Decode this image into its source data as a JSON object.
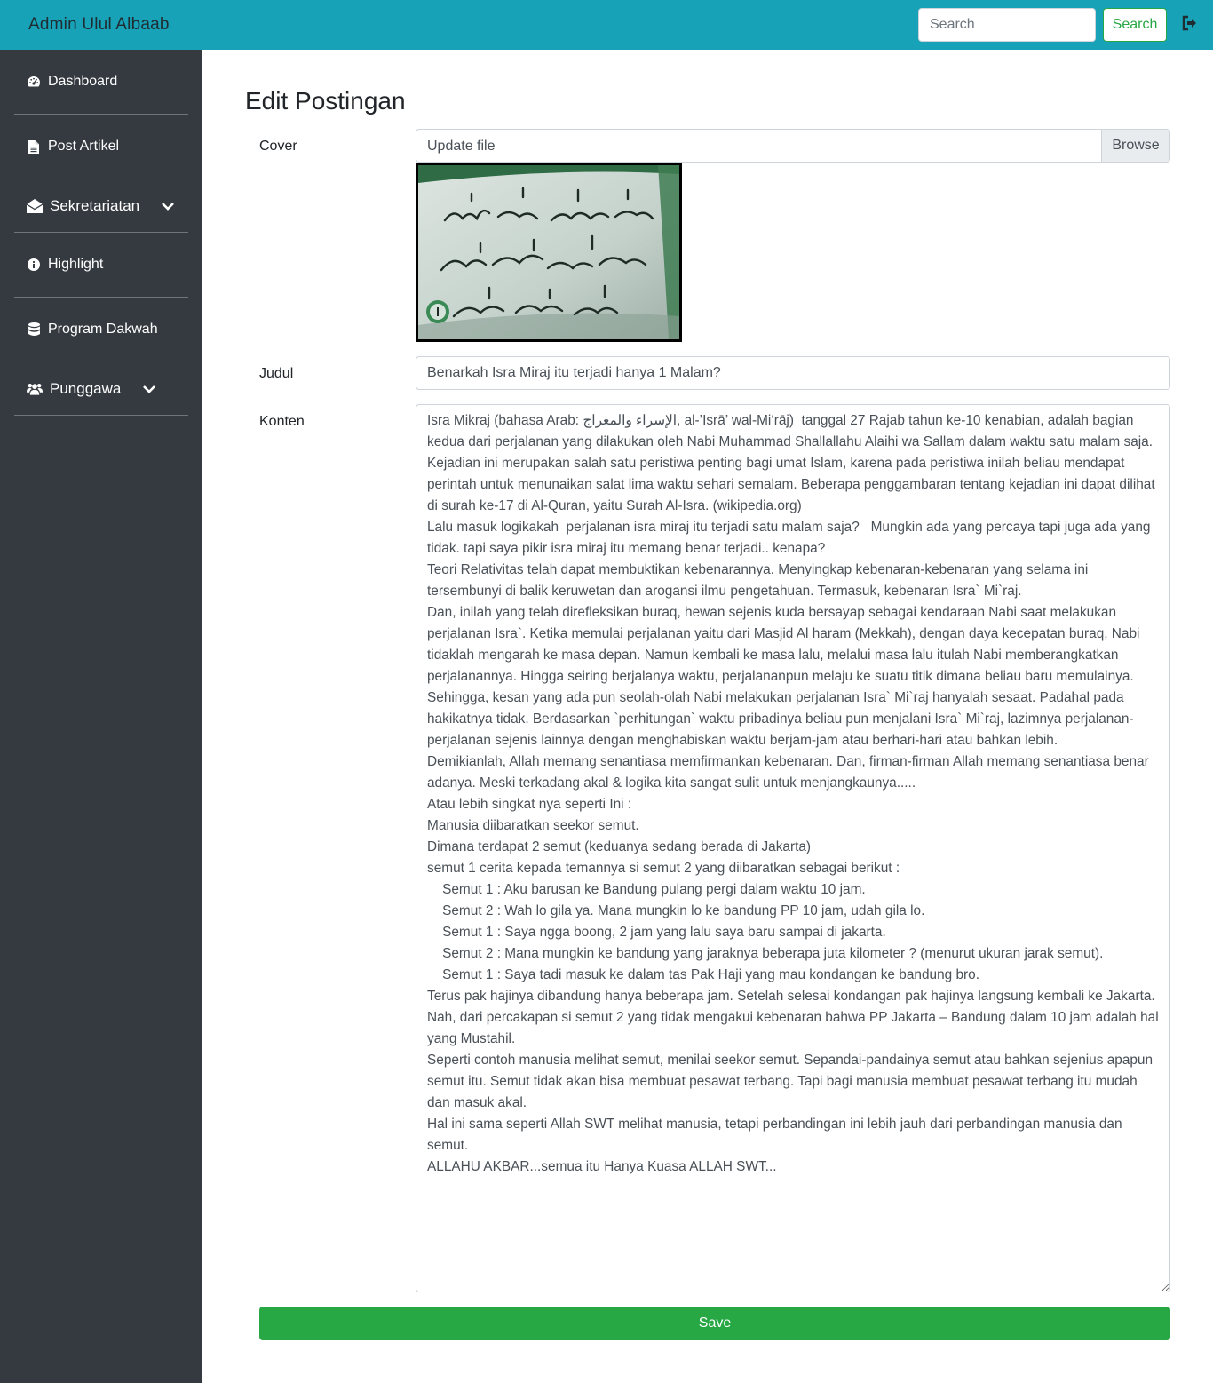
{
  "navbar": {
    "brand": "Admin Ulul Albaab",
    "search_placeholder": "Search",
    "search_button": "Search",
    "logout_icon": "sign-out-icon",
    "color": "#17a2b8"
  },
  "sidebar": {
    "items": [
      {
        "label": "Dashboard",
        "icon": "tachometer-icon"
      },
      {
        "label": "Post Artikel",
        "icon": "file-icon"
      },
      {
        "label": "Sekretariatan",
        "icon": "envelope-open-icon",
        "has_submenu": true
      },
      {
        "label": "Highlight",
        "icon": "info-circle-icon"
      },
      {
        "label": "Program Dakwah",
        "icon": "database-icon"
      },
      {
        "label": "Punggawa",
        "icon": "users-icon",
        "has_submenu": true
      }
    ]
  },
  "form": {
    "title": "Edit Postingan",
    "cover_label": "Cover",
    "file_text": "Update file",
    "browse_label": "Browse",
    "judul_label": "Judul",
    "judul_value": "Benarkah Isra Miraj itu terjadi hanya 1 Malam?",
    "konten_label": "Konten",
    "konten_value": "Isra Mikraj (bahasa Arab: الإسراء والمعراج, al-’Isrā’ wal-Mi‘rāj)  tanggal 27 Rajab tahun ke-10 kenabian, adalah bagian kedua dari perjalanan yang dilakukan oleh Nabi Muhammad Shallallahu Alaihi wa Sallam dalam waktu satu malam saja. Kejadian ini merupakan salah satu peristiwa penting bagi umat Islam, karena pada peristiwa inilah beliau mendapat perintah untuk menunaikan salat lima waktu sehari semalam. Beberapa penggambaran tentang kejadian ini dapat dilihat di surah ke-17 di Al-Quran, yaitu Surah Al-Isra. (wikipedia.org)\nLalu masuk logikakah  perjalanan isra miraj itu terjadi satu malam saja?   Mungkin ada yang percaya tapi juga ada yang tidak. tapi saya pikir isra miraj itu memang benar terjadi.. kenapa?\nTeori Relativitas telah dapat membuktikan kebenarannya. Menyingkap kebenaran-kebenaran yang selama ini tersembunyi di balik keruwetan dan arogansi ilmu pengetahuan. Termasuk, kebenaran Isra` Mi`raj.\nDan, inilah yang telah direfleksikan buraq, hewan sejenis kuda bersayap sebagai kendaraan Nabi saat melakukan perjalanan Isra`. Ketika memulai perjalanan yaitu dari Masjid Al haram (Mekkah), dengan daya kecepatan buraq, Nabi tidaklah mengarah ke masa depan. Namun kembali ke masa lalu, melalui masa lalu itulah Nabi memberangkatkan perjalanannya. Hingga seiring berjalanya waktu, perjalananpun melaju ke suatu titik dimana beliau baru memulainya. Sehingga, kesan yang ada pun seolah-olah Nabi melakukan perjalanan Isra` Mi`raj hanyalah sesaat. Padahal pada hakikatnya tidak. Berdasarkan `perhitungan` waktu pribadinya beliau pun menjalani Isra` Mi`raj, lazimnya perjalanan-perjalanan sejenis lainnya dengan menghabiskan waktu berjam-jam atau berhari-hari atau bahkan lebih.\nDemikianlah, Allah memang senantiasa memfirmankan kebenaran. Dan, firman-firman Allah memang senantiasa benar adanya. Meski terkadang akal & logika kita sangat sulit untuk menjangkaunya.....\nAtau lebih singkat nya seperti Ini :\nManusia diibaratkan seekor semut.\nDimana terdapat 2 semut (keduanya sedang berada di Jakarta)\nsemut 1 cerita kepada temannya si semut 2 yang diibaratkan sebagai berikut :\n    Semut 1 : Aku barusan ke Bandung pulang pergi dalam waktu 10 jam.\n    Semut 2 : Wah lo gila ya. Mana mungkin lo ke bandung PP 10 jam, udah gila lo.\n    Semut 1 : Saya ngga boong, 2 jam yang lalu saya baru sampai di jakarta.\n    Semut 2 : Mana mungkin ke bandung yang jaraknya beberapa juta kilometer ? (menurut ukuran jarak semut).\n    Semut 1 : Saya tadi masuk ke dalam tas Pak Haji yang mau kondangan ke bandung bro.\nTerus pak hajinya dibandung hanya beberapa jam. Setelah selesai kondangan pak hajinya langsung kembali ke Jakarta.\nNah, dari percakapan si semut 2 yang tidak mengakui kebenaran bahwa PP Jakarta – Bandung dalam 10 jam adalah hal yang Mustahil.\nSeperti contoh manusia melihat semut, menilai seekor semut. Sepandai-pandainya semut atau bahkan sejenius apapun semut itu. Semut tidak akan bisa membuat pesawat terbang. Tapi bagi manusia membuat pesawat terbang itu mudah dan masuk akal.\nHal ini sama seperti Allah SWT melihat manusia, tetapi perbandingan ini lebih jauh dari perbandingan manusia dan semut.\nALLAHU AKBAR...semua itu Hanya Kuasa ALLAH SWT...",
    "save_label": "Save"
  }
}
